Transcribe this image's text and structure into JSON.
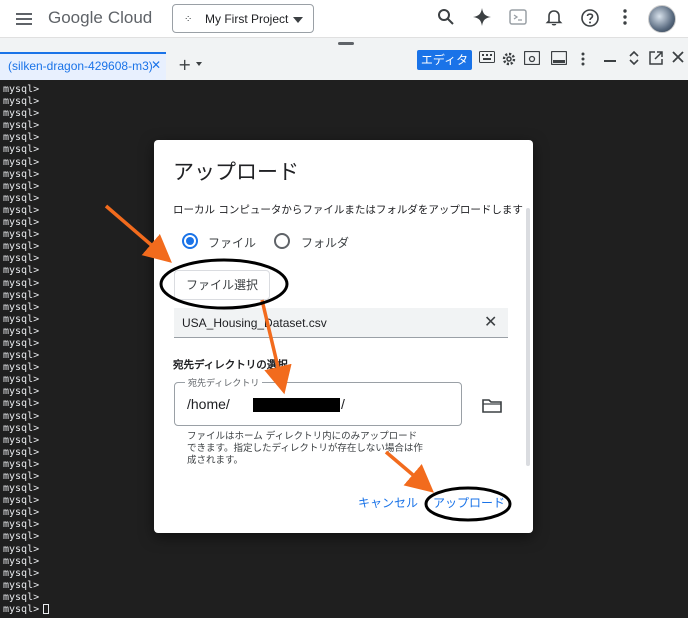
{
  "topbar": {
    "logo_google": "Google",
    "logo_cloud": "Cloud",
    "project_name": "My First Project",
    "icons": [
      "menu-icon",
      "search-icon",
      "gemini-spark-icon",
      "cloud-shell-icon",
      "notifications-icon",
      "help-icon",
      "more-vert-icon",
      "avatar"
    ]
  },
  "tabbar": {
    "tab_label": "(silken-dragon-429608-m3)",
    "tab_close": "✕",
    "add_tab": "+",
    "editor_label": "エディタ",
    "icons": [
      "keyboard-icon",
      "settings-icon",
      "web-preview-icon",
      "layout-icon",
      "more-vert-icon",
      "minimize-icon",
      "expand-icon",
      "open-new-window-icon",
      "close-icon"
    ]
  },
  "terminal": {
    "prompt": "mysql>",
    "line_count": 44
  },
  "dialog": {
    "title": "アップロード",
    "description": "ローカル コンピュータからファイルまたはフォルダをアップロードします",
    "options": [
      {
        "label": "ファイル",
        "selected": true
      },
      {
        "label": "フォルダ",
        "selected": false
      }
    ],
    "choose_file_label": "ファイル選択",
    "selected_file": "USA_Housing_Dataset.csv",
    "destination_heading": "宛先ディレクトリの選択",
    "destination_field_label": "宛先ディレクトリ",
    "destination_value": "/home/",
    "destination_suffix": "/",
    "hint": "ファイルはホーム ディレクトリ内にのみアップロード\nできます。指定したディレクトリが存在しない場合は作\n成されます。",
    "cancel_label": "キャンセル",
    "upload_label": "アップロード"
  },
  "annotations": {
    "arrow_color": "#f26b1d",
    "ellipse_color": "#000000"
  }
}
